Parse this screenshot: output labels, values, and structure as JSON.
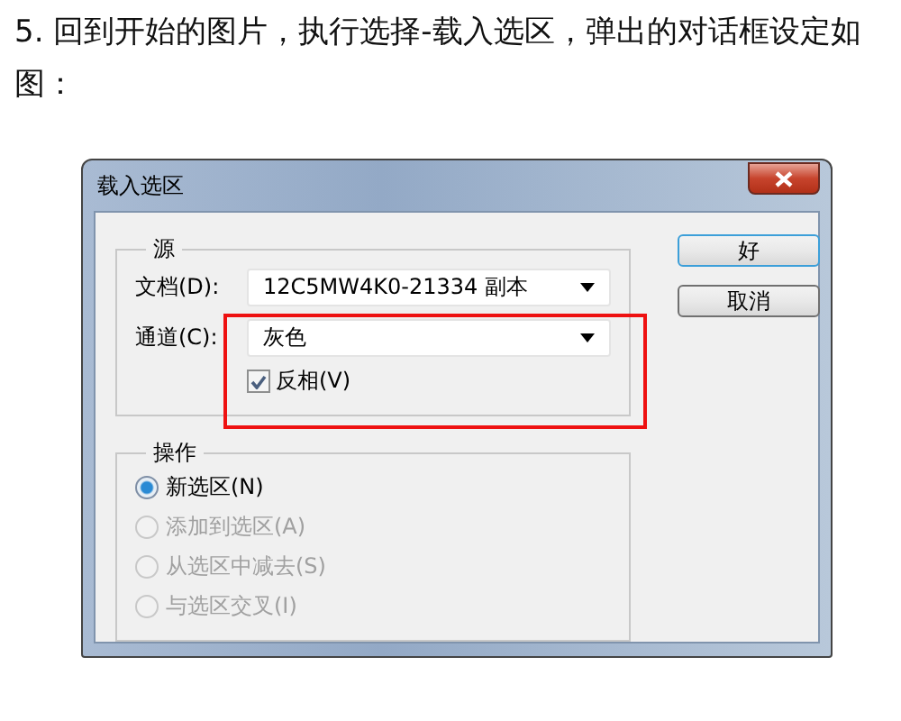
{
  "instruction": "5. 回到开始的图片，执行选择-载入选区，弹出的对话框设定如图：",
  "dialog": {
    "title": "载入选区",
    "source": {
      "legend": "源",
      "document": {
        "label": "文档(D):",
        "value": "12C5MW4K0-21334 副本"
      },
      "channel": {
        "label": "通道(C):",
        "value": "灰色"
      },
      "invert": {
        "label": "反相(V)",
        "checked": true
      }
    },
    "operation": {
      "legend": "操作",
      "options": [
        {
          "label": "新选区(N)",
          "selected": true,
          "disabled": false
        },
        {
          "label": "添加到选区(A)",
          "selected": false,
          "disabled": true
        },
        {
          "label": "从选区中减去(S)",
          "selected": false,
          "disabled": true
        },
        {
          "label": "与选区交叉(I)",
          "selected": false,
          "disabled": true
        }
      ]
    },
    "buttons": [
      {
        "label": "好",
        "default": true
      },
      {
        "label": "取消",
        "default": false
      }
    ]
  }
}
